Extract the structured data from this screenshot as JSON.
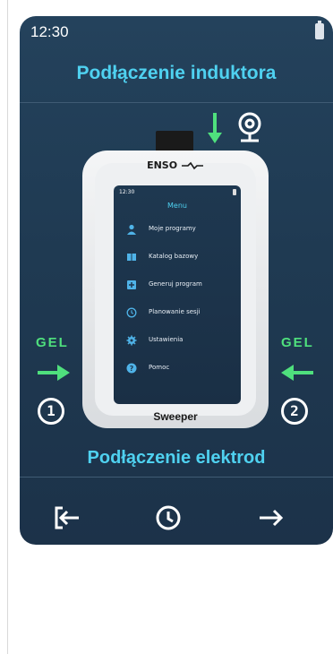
{
  "status": {
    "time": "12:30"
  },
  "header": {
    "title": "Podłączenie induktora"
  },
  "device": {
    "logo": "ENSO",
    "brand": "Sweeper",
    "screen": {
      "time": "12:30",
      "menu_title": "Menu",
      "items": [
        {
          "label": "Moje programy",
          "icon": "user-icon",
          "color": "#4fb3e8"
        },
        {
          "label": "Katalog bazowy",
          "icon": "book-icon",
          "color": "#4fb3e8"
        },
        {
          "label": "Generuj program",
          "icon": "plus-icon",
          "color": "#4fb3e8"
        },
        {
          "label": "Planowanie sesji",
          "icon": "clock-icon",
          "color": "#4fb3e8"
        },
        {
          "label": "Ustawienia",
          "icon": "gear-icon",
          "color": "#4fb3e8"
        },
        {
          "label": "Pomoc",
          "icon": "help-icon",
          "color": "#4fb3e8"
        }
      ]
    }
  },
  "left_electrode": {
    "gel": "GEL",
    "number": "1"
  },
  "right_electrode": {
    "gel": "GEL",
    "number": "2"
  },
  "footer": {
    "title": "Podłączenie elektrod"
  },
  "colors": {
    "accent": "#4fd1f0",
    "green": "#4fe07d",
    "background": "#1f3a52"
  }
}
